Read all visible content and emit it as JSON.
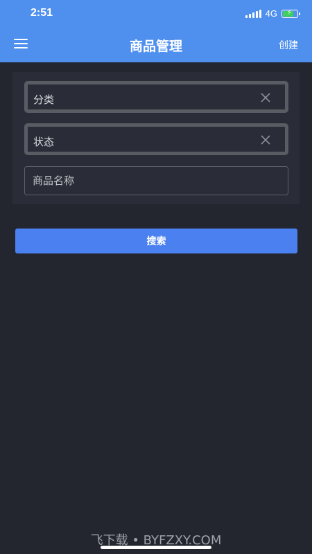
{
  "status_bar": {
    "time": "2:51",
    "network": "4G",
    "battery_color": "#3ed15b",
    "battery_level": 0.75
  },
  "nav": {
    "title": "商品管理",
    "create_label": "创建",
    "menu_icon": "hamburger-icon",
    "bg_color": "#4f90ef"
  },
  "filters": {
    "category_label": "分类",
    "status_label": "状态",
    "clear_icon": "close-icon",
    "name_placeholder": "商品名称"
  },
  "search_label": "搜索",
  "search_color": "#4a80ef",
  "watermark": "飞下载 • BYFZXY.COM"
}
